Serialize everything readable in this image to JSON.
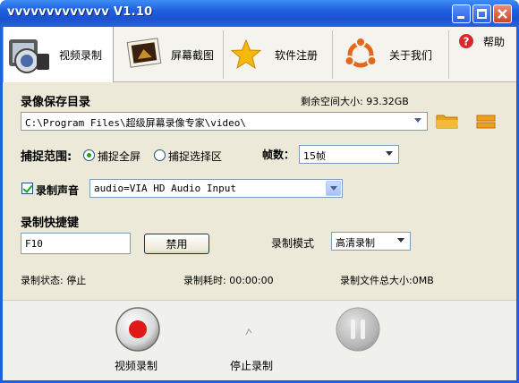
{
  "window": {
    "title": "vvvvvvvvvvvvv V1.10"
  },
  "tabs": [
    {
      "label": "视频录制"
    },
    {
      "label": "屏幕截图"
    },
    {
      "label": "软件注册"
    },
    {
      "label": "关于我们"
    },
    {
      "label": "帮助"
    }
  ],
  "save_dir": {
    "title": "录像保存目录",
    "free_space_label": "剩余空间大小: 93.32GB",
    "path": "C:\\Program Files\\超级屏幕录像专家\\video\\"
  },
  "capture": {
    "title": "捕捉范围:",
    "full_screen": "捕捉全屏",
    "select_area": "捕捉选择区",
    "fps_label": "帧数：",
    "fps_value": "15帧"
  },
  "audio": {
    "label": "录制声音",
    "device": "audio=VIA HD Audio Input"
  },
  "hotkey": {
    "title": "录制快捷键",
    "value": "F10",
    "disable_btn": "禁用",
    "mode_label": "录制模式",
    "mode_value": "高清录制"
  },
  "status": {
    "state": "录制状态: 停止",
    "elapsed": "录制耗时: 00:00:00",
    "total_size": "录制文件总大小:0MB"
  },
  "controls": {
    "record": "视频录制",
    "stop": "停止录制"
  },
  "colors": {
    "title_blue": "#1f5fe0",
    "record_red": "#e01818",
    "check_green": "#21a121"
  }
}
